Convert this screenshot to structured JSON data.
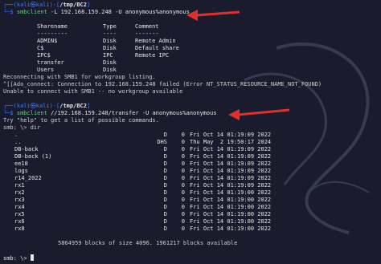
{
  "prompt": {
    "user": "(kali㉿kali)",
    "path": "/tmp/BC2",
    "top_prefix": "┌──",
    "bottom_prefix": "└─$"
  },
  "cmd1": {
    "program": "smbclient",
    "args": "-L 192.168.159.248 -U anonymous%anonymous"
  },
  "shares": {
    "headers": [
      "Sharename",
      "Type",
      "Comment"
    ],
    "separators": [
      "---------",
      "----",
      "-------"
    ],
    "rows": [
      [
        "ADMIN$",
        "Disk",
        "Remote Admin"
      ],
      [
        "C$",
        "Disk",
        "Default share"
      ],
      [
        "IPC$",
        "IPC",
        "Remote IPC"
      ],
      [
        "transfer",
        "Disk",
        ""
      ],
      [
        "Users",
        "Disk",
        ""
      ]
    ]
  },
  "msgs1": [
    "Reconnecting with SMB1 for workgroup listing.",
    "^[[Ado_connect: Connection to 192.168.159.248 failed (Error NT_STATUS_RESOURCE_NAME_NOT_FOUND)",
    "Unable to connect with SMB1 -- no workgroup available"
  ],
  "cmd2": {
    "program": "smbclient",
    "args": "//192.168.159.248/transfer -U anonymous%anonymous"
  },
  "msgs2": [
    "Try \"help\" to get a list of possible commands.",
    "smb: \\> dir"
  ],
  "listing": [
    [
      ".",
      "D",
      "0",
      "Fri Oct 14 01:19:09 2022"
    ],
    [
      "..",
      "DHS",
      "0",
      "Thu May  2 19:50:17 2024"
    ],
    [
      "DB-back",
      "D",
      "0",
      "Fri Oct 14 01:19:09 2022"
    ],
    [
      "DB-back (1)",
      "D",
      "0",
      "Fri Oct 14 01:19:09 2022"
    ],
    [
      "ee18",
      "D",
      "0",
      "Fri Oct 14 01:19:09 2022"
    ],
    [
      "logs",
      "D",
      "0",
      "Fri Oct 14 01:19:09 2022"
    ],
    [
      "r14_2022",
      "D",
      "0",
      "Fri Oct 14 01:19:09 2022"
    ],
    [
      "rx1",
      "D",
      "0",
      "Fri Oct 14 01:19:09 2022"
    ],
    [
      "rx2",
      "D",
      "0",
      "Fri Oct 14 01:19:00 2022"
    ],
    [
      "rx3",
      "D",
      "0",
      "Fri Oct 14 01:19:00 2022"
    ],
    [
      "rx4",
      "D",
      "0",
      "Fri Oct 14 01:19:00 2022"
    ],
    [
      "rx5",
      "D",
      "0",
      "Fri Oct 14 01:19:00 2022"
    ],
    [
      "rx6",
      "D",
      "0",
      "Fri Oct 14 01:19:00 2022"
    ],
    [
      "rx8",
      "D",
      "0",
      "Fri Oct 14 01:19:00 2022"
    ]
  ],
  "blocks_msg": "5864959 blocks of size 4096. 1961217 blocks available",
  "final_prompt": "smb: \\> ",
  "colors": {
    "arrow": "#e0302a",
    "prompt": "#3d7bff",
    "command": "#66d17a"
  }
}
